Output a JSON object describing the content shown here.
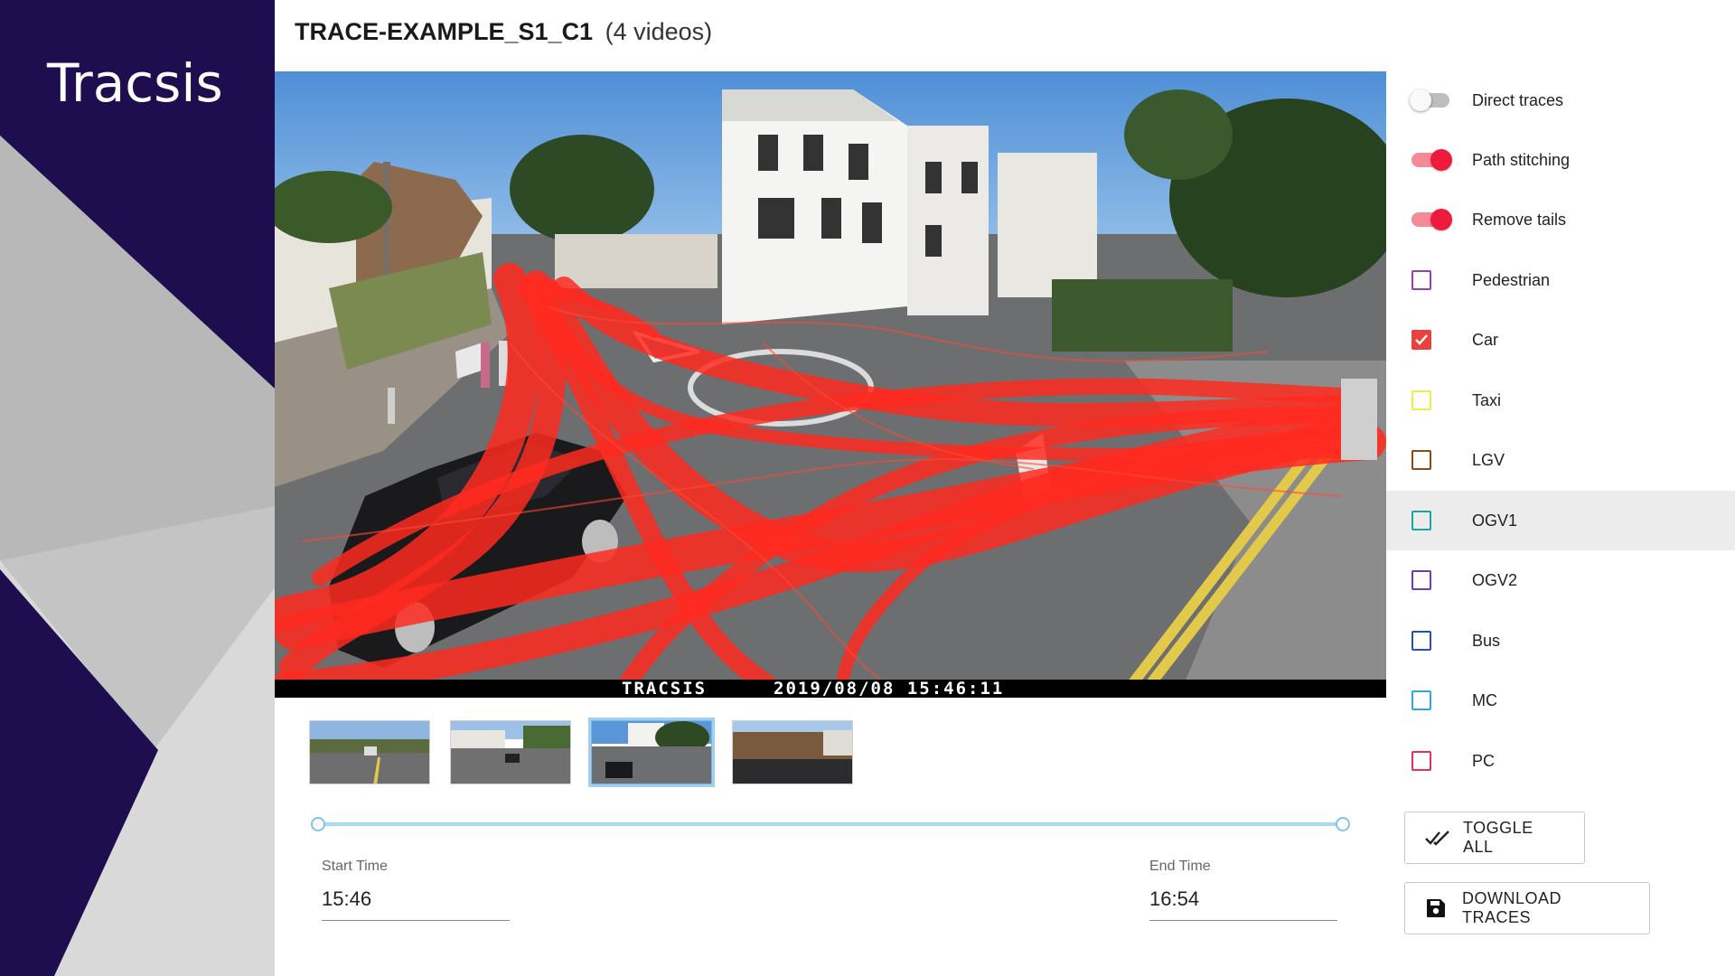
{
  "brand": {
    "logo_text": "Tracsis",
    "colors": {
      "navy": "#1e0e4f",
      "dot": "#2fb44a"
    }
  },
  "header": {
    "title": "TRACE-EXAMPLE_S1_C1",
    "count": "(4 videos)"
  },
  "video": {
    "overlay_brand": "TRACSIS",
    "overlay_timestamp": "2019/08/08 15:46:11",
    "trace_color": "#ff2a20"
  },
  "thumbnails": [
    {
      "label": "video-1",
      "selected": false
    },
    {
      "label": "video-2",
      "selected": false
    },
    {
      "label": "video-3",
      "selected": true
    },
    {
      "label": "video-4",
      "selected": false
    }
  ],
  "time_range": {
    "start_label": "Start Time",
    "start_value": "15:46",
    "end_label": "End Time",
    "end_value": "16:54"
  },
  "options": {
    "toggles": [
      {
        "label": "Direct traces",
        "on": false
      },
      {
        "label": "Path stitching",
        "on": true
      },
      {
        "label": "Remove tails",
        "on": true
      }
    ],
    "classes": [
      {
        "label": "Pedestrian",
        "checked": false,
        "color": "#8e44ad"
      },
      {
        "label": "Car",
        "checked": true,
        "color": "#e8423f"
      },
      {
        "label": "Taxi",
        "checked": false,
        "color": "#e6f04a"
      },
      {
        "label": "LGV",
        "checked": false,
        "color": "#8a4a1c"
      },
      {
        "label": "OGV1",
        "checked": false,
        "color": "#1aa6a0"
      },
      {
        "label": "OGV2",
        "checked": false,
        "color": "#6a3fb0"
      },
      {
        "label": "Bus",
        "checked": false,
        "color": "#2a4fa8"
      },
      {
        "label": "MC",
        "checked": false,
        "color": "#2fa7dc"
      },
      {
        "label": "PC",
        "checked": false,
        "color": "#e0325a"
      }
    ],
    "hovered_class": "OGV1"
  },
  "buttons": {
    "toggle_all": "TOGGLE ALL",
    "download": "DOWNLOAD TRACES"
  }
}
